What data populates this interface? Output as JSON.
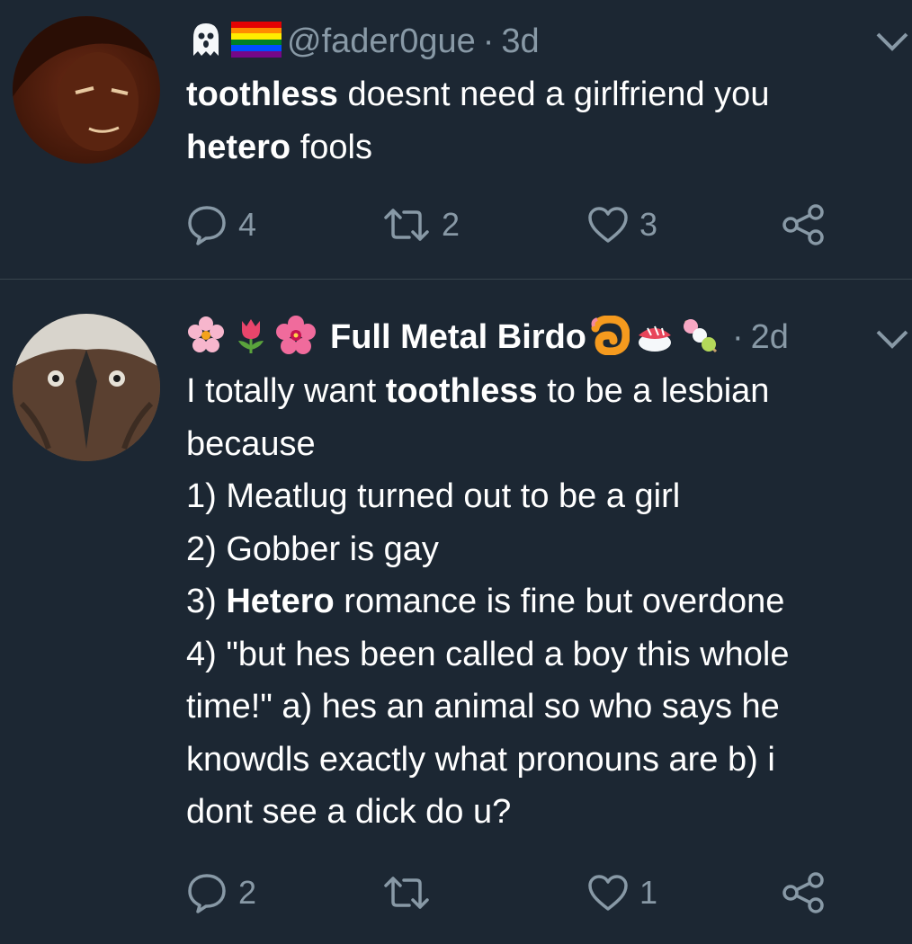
{
  "tweets": [
    {
      "handle": "@fader0gue",
      "time": "3d",
      "text_parts": [
        "toothless",
        " doesnt need a girlfriend you",
        "hetero",
        " fools"
      ],
      "counts": {
        "reply": "4",
        "retweet": "2",
        "like": "3"
      }
    },
    {
      "display_name": "Full Metal Birdo",
      "time": "2d",
      "lines": [
        [
          "I totally want ",
          "toothless",
          " to be a lesbian"
        ],
        "because",
        "1) Meatlug turned out to be a girl",
        "2) Gobber is gay",
        [
          "3) ",
          "Hetero",
          " romance is fine but overdone"
        ],
        "4) \"but hes been called a boy this whole",
        "time!\" a) hes an animal so who says he",
        "knowdls exactly what pronouns are b) i",
        "dont see a dick do u?"
      ],
      "counts": {
        "reply": "2",
        "retweet": "",
        "like": "1"
      }
    }
  ],
  "colors": {
    "background": "#1c2733",
    "text": "#ffffff",
    "secondary": "#8899a6",
    "divider": "#38444d"
  },
  "icons": [
    "ghost-icon",
    "rainbow-flag-icon",
    "cherry-blossom-icon",
    "tulip-icon",
    "hibiscus-icon",
    "shrimp-icon",
    "sushi-icon",
    "dango-icon",
    "caret-down-icon",
    "reply-icon",
    "retweet-icon",
    "like-icon",
    "share-icon"
  ]
}
